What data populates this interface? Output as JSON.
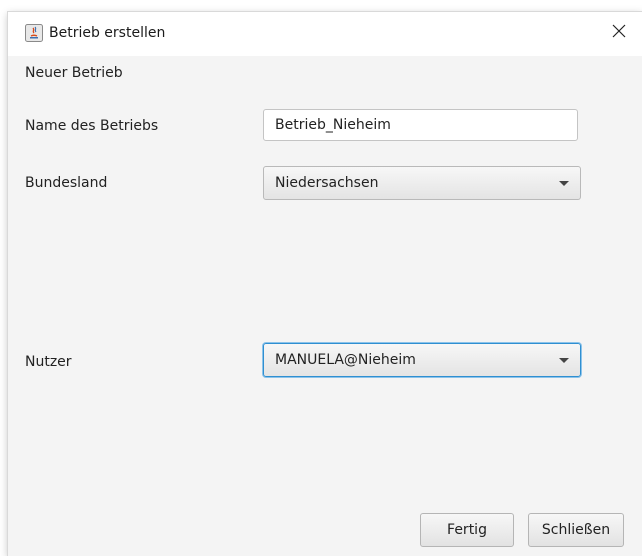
{
  "window": {
    "title": "Betrieb erstellen",
    "app_icon": "java-icon",
    "close_icon": "close-icon"
  },
  "form": {
    "heading": "Neuer Betrieb",
    "name_label": "Name des Betriebs",
    "name_value": "Betrieb_Nieheim",
    "state_label": "Bundesland",
    "state_value": "Niedersachsen",
    "user_label": "Nutzer",
    "user_value": "MANUELA@Nieheim"
  },
  "buttons": {
    "done_label": "Fertig",
    "close_label": "Schließen"
  },
  "colors": {
    "focus_border": "#2f8fd1",
    "window_bg": "#f4f4f4"
  }
}
